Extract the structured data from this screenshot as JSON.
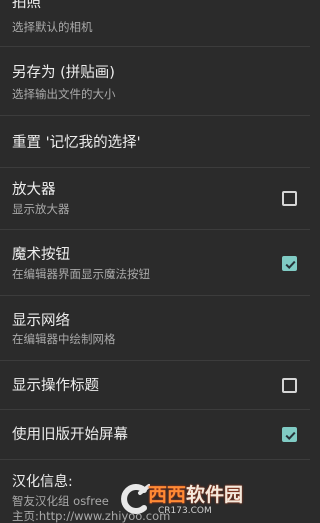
{
  "prefs": {
    "camera": {
      "title": "拍照",
      "summary": "选择默认的相机"
    },
    "save_as": {
      "title": "另存为 (拼贴画)",
      "summary": "选择输出文件的大小"
    },
    "reset": {
      "title": "重置 '记忆我的选择'"
    },
    "magnifier": {
      "title": "放大器",
      "summary": "显示放大器",
      "checked": false
    },
    "magic_button": {
      "title": "魔术按钮",
      "summary": "在编辑器界面显示魔法按钮",
      "checked": true
    },
    "show_grid": {
      "title": "显示网络",
      "summary": "在编辑器中绘制网格"
    },
    "show_action_title": {
      "title": "显示操作标题",
      "checked": false
    },
    "legacy_start": {
      "title": "使用旧版开始屏幕",
      "checked": true
    }
  },
  "about": {
    "title": "汉化信息:",
    "line1": "智友汉化组 osfree",
    "line2": "主页:http://www.zhiyoo.com"
  },
  "watermark": {
    "name_a": "西西",
    "name_b": "软件园",
    "url": "CR173.COM"
  },
  "colors": {
    "background": "#2b2b2b",
    "divider": "#3c3c3c",
    "accent": "#80cbc4",
    "title_text": "#ededed",
    "summary_text": "#a9a9a9"
  }
}
